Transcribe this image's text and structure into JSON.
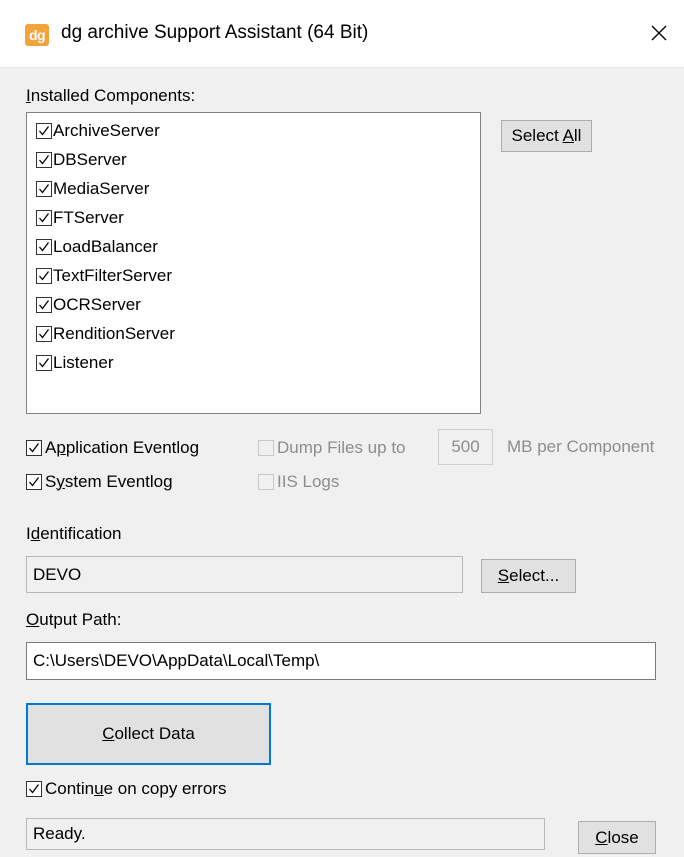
{
  "window": {
    "icon_text": "dg",
    "title": "dg archive Support Assistant (64 Bit)"
  },
  "components": {
    "label": "Installed Components:",
    "items": [
      {
        "label": "ArchiveServer",
        "checked": true
      },
      {
        "label": "DBServer",
        "checked": true
      },
      {
        "label": "MediaServer",
        "checked": true
      },
      {
        "label": "FTServer",
        "checked": true
      },
      {
        "label": "LoadBalancer",
        "checked": true
      },
      {
        "label": "TextFilterServer",
        "checked": true
      },
      {
        "label": "OCRServer",
        "checked": true
      },
      {
        "label": "RenditionServer",
        "checked": true
      },
      {
        "label": "Listener",
        "checked": true
      }
    ],
    "select_all_label": "Select All"
  },
  "options": {
    "application_eventlog": {
      "label": "Application Eventlog",
      "checked": true
    },
    "system_eventlog": {
      "label": "System Eventlog",
      "checked": true
    },
    "dump_files": {
      "label": "Dump Files up to",
      "checked": false,
      "enabled": false
    },
    "dump_size": "500",
    "dump_unit": "MB per Component",
    "iis_logs": {
      "label": "IIS Logs",
      "checked": false,
      "enabled": false
    }
  },
  "identification": {
    "label": "Identification",
    "value": "DEVO",
    "select_label": "Select..."
  },
  "output": {
    "label": "Output Path:",
    "value": "C:\\Users\\DEVO\\AppData\\Local\\Temp\\"
  },
  "collect_label": "Collect Data",
  "continue_on_errors": {
    "label": "Continue on copy errors",
    "checked": true
  },
  "status": "Ready.",
  "close_label": "Close"
}
